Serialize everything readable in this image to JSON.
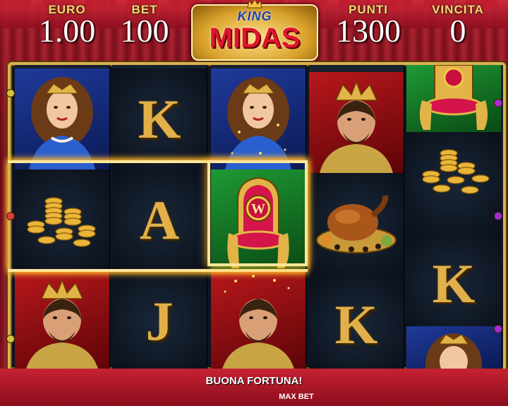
{
  "header": {
    "euro": {
      "label": "EURO",
      "value": "1.00"
    },
    "bet": {
      "label": "BET",
      "value": "100"
    },
    "punti": {
      "label": "PUNTI",
      "value": "1300"
    },
    "vincita": {
      "label": "VINCITA",
      "value": "0"
    }
  },
  "logo": {
    "line1": "KING",
    "line2": "MIDAS"
  },
  "reels": [
    [
      "queen",
      "coins",
      "king"
    ],
    [
      "K",
      "A",
      "J"
    ],
    [
      "queen",
      "throne",
      "king"
    ],
    [
      "king",
      "roast-chicken",
      "K"
    ],
    [
      "throne",
      "coins",
      "K",
      "queen"
    ]
  ],
  "letters": {
    "reel2_top": "K",
    "reel2_mid": "A",
    "reel2_bot": "J",
    "reel4_bot": "K",
    "reel5_mid": "K"
  },
  "throne_letter": "W",
  "footer": {
    "message": "BUONA FORTUNA!",
    "max_bet": "MAX BET"
  },
  "colors": {
    "gold": "#e1b04b",
    "curtain": "#a31425",
    "win_glow": "#ffb72c"
  }
}
